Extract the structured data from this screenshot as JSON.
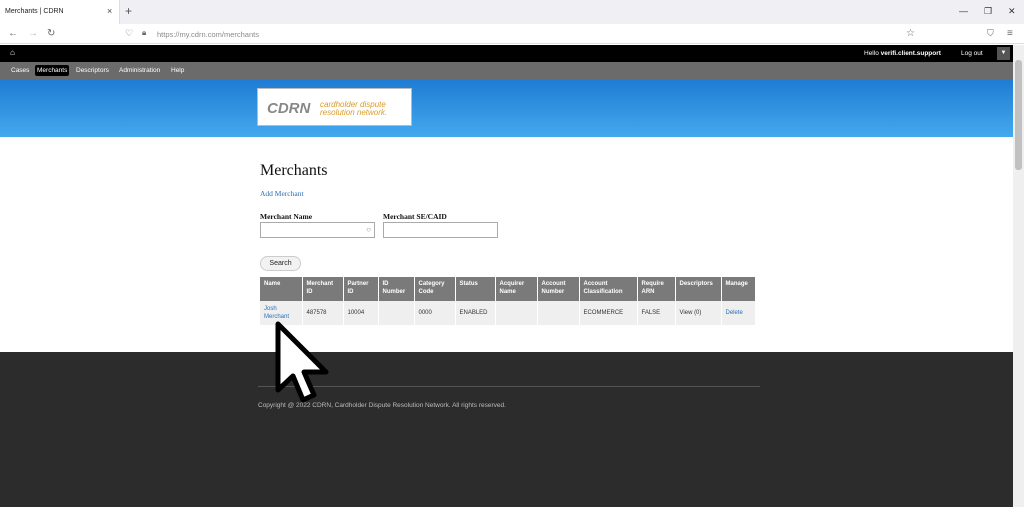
{
  "browser": {
    "tab_title": "Merchants | CDRN",
    "close_symbol": "×",
    "new_tab_symbol": "+",
    "url": "https://my.cdrn.com/merchants",
    "win_min": "—",
    "win_max": "❐",
    "win_close": "✕"
  },
  "header": {
    "hello_prefix": "Hello ",
    "username": "verifi.client.support",
    "logout": "Log out"
  },
  "menu": {
    "items": [
      "Cases",
      "Merchants",
      "Descriptors",
      "Administration",
      "Help"
    ],
    "active": "Merchants"
  },
  "logo": {
    "brand": "CDRN",
    "tagline_1": "cardholder dispute",
    "tagline_2": "resolution network."
  },
  "page": {
    "title": "Merchants",
    "add_link": "Add Merchant",
    "merchant_name_label": "Merchant Name",
    "merchant_secaid_label": "Merchant SE/CAID",
    "search_button": "Search"
  },
  "table": {
    "headers": [
      "Name",
      "Merchant ID",
      "Partner ID",
      "ID Number",
      "Category Code",
      "Status",
      "Acquirer Name",
      "Account Number",
      "Account Classification",
      "Require ARN",
      "Descriptors",
      "Manage"
    ],
    "rows": [
      {
        "name": "Josh Merchant",
        "merchant_id": "487578",
        "partner_id": "10004",
        "id_number": "",
        "category_code": "0000",
        "status": "ENABLED",
        "acquirer_name": "",
        "account_number": "",
        "account_classification": "ECOMMERCE",
        "require_arn": "FALSE",
        "descriptors": "View (0)",
        "manage": "Delete"
      }
    ]
  },
  "footer": {
    "copyright": "Copyright @ 2022 CDRN, Cardholder Dispute Resolution Network. All rights reserved."
  },
  "colors": {
    "banner": "#2f8fe0",
    "link": "#2a6fb5",
    "footer": "#2c2c2c"
  }
}
